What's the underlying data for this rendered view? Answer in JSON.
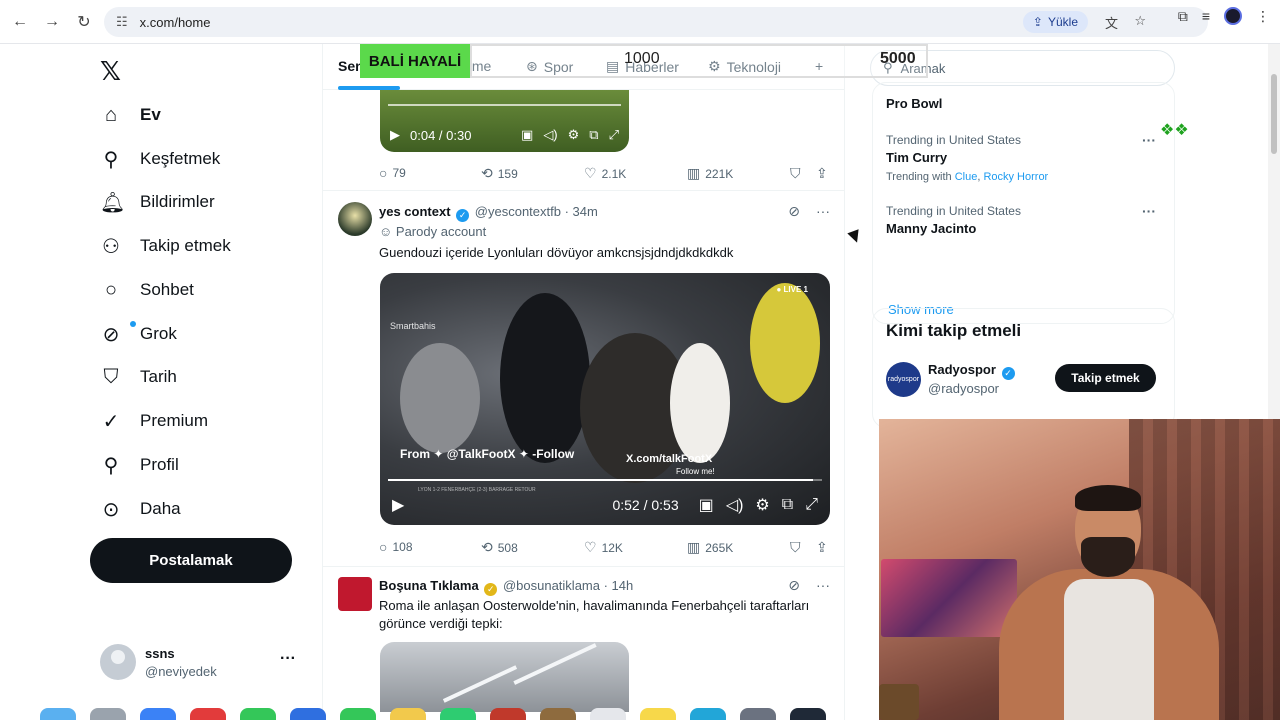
{
  "browser": {
    "url": "x.com/home",
    "upload_label": "Yükle"
  },
  "nav": {
    "items": [
      {
        "label": "Ev"
      },
      {
        "label": "Keşfetmek"
      },
      {
        "label": "Bildirimler"
      },
      {
        "label": "Takip etmek"
      },
      {
        "label": "Sohbet"
      },
      {
        "label": "Grok"
      },
      {
        "label": "Tarih"
      },
      {
        "label": "Premium"
      },
      {
        "label": "Profil"
      },
      {
        "label": "Daha"
      }
    ],
    "post_button": "Postalamak",
    "account": {
      "name": "ssns",
      "handle": "@neviyedek"
    }
  },
  "tabs": [
    {
      "label": "Sen"
    },
    {
      "label": "tme"
    },
    {
      "label": "Spor"
    },
    {
      "label": "Haberler"
    },
    {
      "label": "Teknoloji"
    }
  ],
  "overlay": {
    "banner": "BALİ HAYALİ",
    "goal_current": "1000",
    "goal_target": "5000"
  },
  "tweet1": {
    "video_time": "0:04 / 0:30",
    "replies": "79",
    "reposts": "159",
    "likes": "2.1K",
    "views": "221K"
  },
  "tweet2": {
    "name": "yes context",
    "handle": "@yescontextfb",
    "time": "· 34m",
    "parody": "Parody account",
    "text": "Guendouzi içeride Lyonluları dövüyor amkcnsjsjdndjdkdkdkdk",
    "video": {
      "live": "● LIVE 1",
      "watermark": "Smartbahis",
      "from": "From ✦ @TalkFootX ✦ -Follow",
      "xcom": "X.com/talkFootX",
      "follow_me": "Follow me!",
      "caption": "LYON 1-2 FENERBAHÇE (2-3) BARRAGE RETOUR",
      "time": "0:52 / 0:53"
    },
    "replies": "108",
    "reposts": "508",
    "likes": "12K",
    "views": "265K"
  },
  "tweet3": {
    "name": "Boşuna Tıklama",
    "handle": "@bosunatiklama",
    "time": "· 14h",
    "text": "Roma ile anlaşan Oosterwolde'nin, havalimanında Fenerbahçeli taraftarları görünce verdiği tepki:"
  },
  "right": {
    "search_placeholder": "Aramak",
    "trends": [
      {
        "context": "",
        "name": "Pro Bowl"
      },
      {
        "context": "Trending in United States",
        "name": "Tim Curry",
        "with_label": "Trending with",
        "with_1": "Clue",
        "with_2": "Rocky Horror"
      },
      {
        "context": "Trending in United States",
        "name": "Manny Jacinto"
      }
    ],
    "show_more": "Show more",
    "who_to_follow": "Kimi takip etmeli",
    "suggestion": {
      "name": "Radyospor",
      "handle": "@radyospor",
      "avatar_text": "radyospor",
      "button": "Takip etmek"
    }
  },
  "colors": {
    "accent": "#1d9bf0",
    "banner_green": "#5bd94b",
    "ink": "#0f1419",
    "muted": "#536471"
  }
}
